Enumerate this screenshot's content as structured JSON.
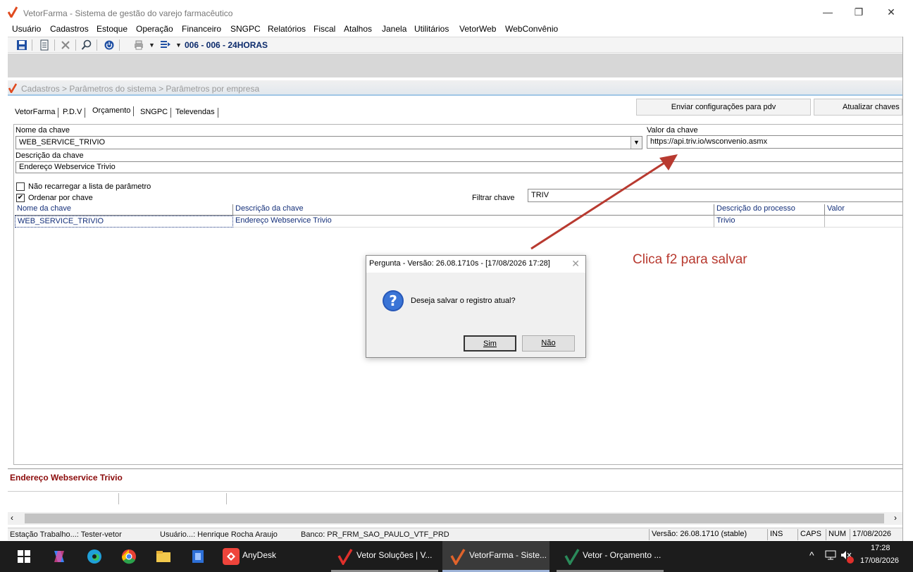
{
  "window": {
    "title": "VetorFarma - Sistema de gestão do varejo farmacêutico",
    "controls": {
      "minimize": "—",
      "restore": "❐",
      "close": "✕"
    }
  },
  "menu": [
    "Usuário",
    "Cadastros",
    "Estoque",
    "Operação",
    "Financeiro",
    "SNGPC",
    "Relatórios",
    "Fiscal",
    "Atalhos",
    "Janela",
    "Utilitários",
    "VetorWeb",
    "WebConvênio"
  ],
  "toolbar": {
    "workstation": "006 - 006 - 24HORAS"
  },
  "breadcrumb": "Cadastros > Parâmetros do sistema > Parâmetros por empresa",
  "tabs": [
    "VetorFarma",
    "P.D.V",
    "Orçamento",
    "SNGPC",
    "Televendas"
  ],
  "buttons": {
    "send_config": "Enviar configurações para  pdv",
    "update_keys": "Atualizar chaves"
  },
  "form": {
    "key_name_label": "Nome da chave",
    "key_name_value": "WEB_SERVICE_TRIVIO",
    "key_value_label": "Valor da chave",
    "key_value_value": "https://api.triv.io/wsconvenio.asmx",
    "key_desc_label": "Descrição da chave",
    "key_desc_value": "Endereço Webservice Trivio",
    "no_reload_label": "Não recarregar a lista de parâmetro",
    "no_reload_checked": false,
    "order_by_key_label": "Ordenar por chave",
    "order_by_key_checked": true,
    "filter_label": "Filtrar chave",
    "filter_value": "TRIV"
  },
  "grid": {
    "columns": [
      "Nome da chave",
      "Descrição  da chave",
      "Descrição do processo",
      "Valor"
    ],
    "rows": [
      [
        "WEB_SERVICE_TRIVIO",
        "Endereço Webservice Trivio",
        "Trivio",
        ""
      ]
    ]
  },
  "dialog": {
    "title": "Pergunta - Versão: 26.08.1710s - [17/08/2026 17:28]",
    "message": "Deseja salvar o registro atual?",
    "yes": "Sim",
    "no": "Não"
  },
  "annotation": "Clica f2 para salvar",
  "description_bar": "Endereço Webservice Trivio",
  "status": {
    "station": "Estação Trabalho...:  Tester-vetor",
    "user": "Usuário...: Henrique Rocha Araujo",
    "bank": "Banco: PR_FRM_SAO_PAULO_VTF_PRD",
    "version": "Versão: 26.08.1710 (stable)",
    "ins": "INS",
    "caps": "CAPS",
    "num": "NUM",
    "date": "17/08/2026"
  },
  "taskbar": {
    "apps": [
      "AnyDesk",
      "Vetor Soluções  |  V...",
      "VetorFarma - Siste...",
      "Vetor - Orçamento ..."
    ],
    "time": "17:28",
    "date": "17/08/2026"
  },
  "colors": {
    "accent_red": "#d9472b",
    "annotation_red": "#b83a30",
    "link_blue": "#15307a",
    "desc_red": "#8b0a0a"
  }
}
